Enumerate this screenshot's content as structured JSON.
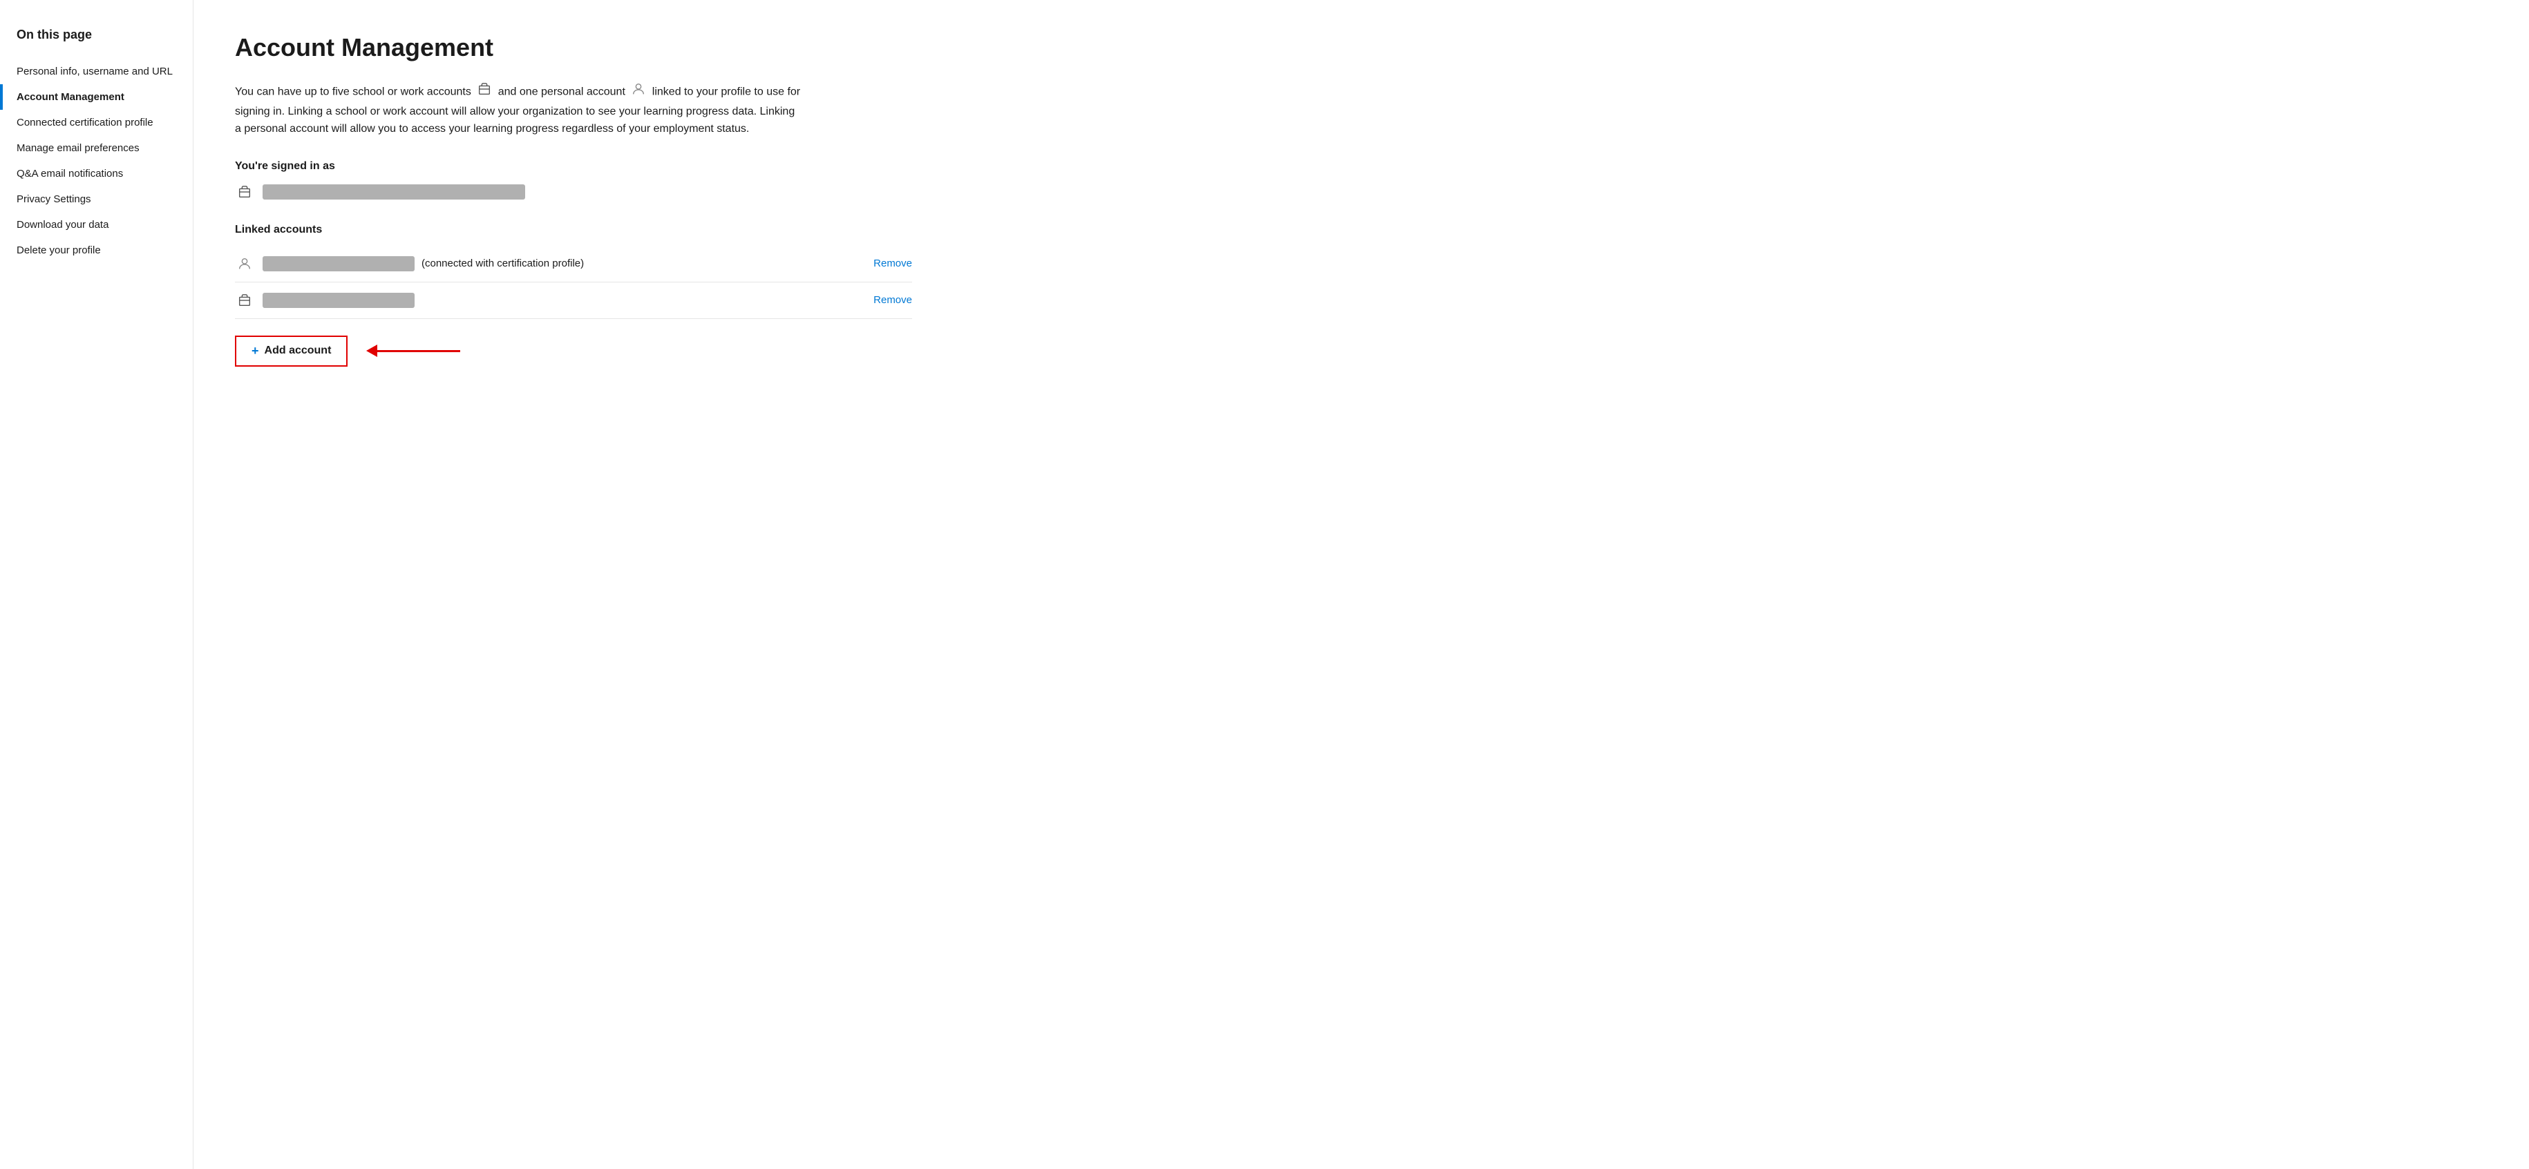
{
  "sidebar": {
    "title": "On this page",
    "items": [
      {
        "id": "personal-info",
        "label": "Personal info, username and URL",
        "active": false
      },
      {
        "id": "account-management",
        "label": "Account Management",
        "active": true
      },
      {
        "id": "connected-certification",
        "label": "Connected certification profile",
        "active": false
      },
      {
        "id": "manage-email",
        "label": "Manage email preferences",
        "active": false
      },
      {
        "id": "qa-email",
        "label": "Q&A email notifications",
        "active": false
      },
      {
        "id": "privacy-settings",
        "label": "Privacy Settings",
        "active": false
      },
      {
        "id": "download-data",
        "label": "Download your data",
        "active": false
      },
      {
        "id": "delete-profile",
        "label": "Delete your profile",
        "active": false
      }
    ]
  },
  "main": {
    "title": "Account Management",
    "description_parts": {
      "before_work_icon": "You can have up to five school or work accounts",
      "between_icons": "and one personal account",
      "after_person_icon": "linked to your profile to use for signing in. Linking a school or work account will allow your organization to see your learning progress data. Linking a personal account will allow you to access your learning progress regardless of your employment status."
    },
    "signed_in_section": {
      "label": "You're signed in as"
    },
    "linked_accounts_section": {
      "label": "Linked accounts",
      "accounts": [
        {
          "type": "personal",
          "cert_note": "(connected with certification profile)",
          "remove_label": "Remove"
        },
        {
          "type": "work",
          "cert_note": "",
          "remove_label": "Remove"
        }
      ]
    },
    "add_account": {
      "label": "Add account",
      "plus_symbol": "+"
    }
  }
}
